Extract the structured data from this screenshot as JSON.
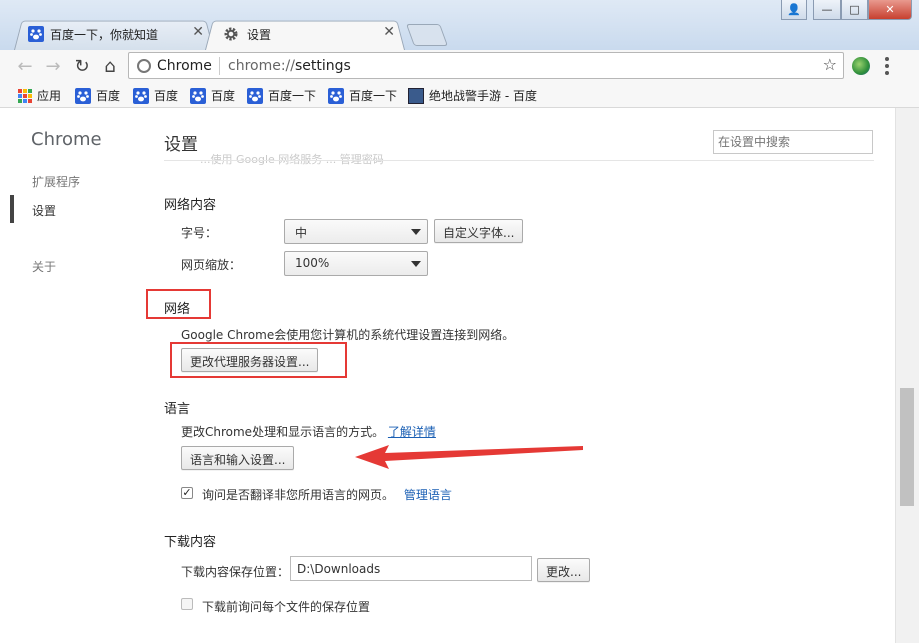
{
  "tabs": [
    {
      "label": "百度一下，你就知道",
      "icon": "baidu-paw-icon"
    },
    {
      "label": "设置",
      "icon": "gear-icon"
    }
  ],
  "window_controls": {
    "user": "👤",
    "minimize": "—",
    "maximize": "□",
    "close": "✕"
  },
  "omnibox": {
    "chip_label": "Chrome",
    "url_scheme": "chrome://",
    "url_path": "settings"
  },
  "bookmarks": {
    "apps_label": "应用",
    "items": [
      "百度",
      "百度",
      "百度",
      "百度一下",
      "百度一下",
      "绝地战警手游 - 百度"
    ]
  },
  "sidebar": {
    "title": "Chrome",
    "items": [
      "扩展程序",
      "设置",
      "关于"
    ]
  },
  "settings": {
    "title": "设置",
    "search_placeholder": "在设置中搜索",
    "faded_text": "...使用 Google 网络服务 ... 管理密码",
    "web_content": {
      "heading": "网络内容",
      "font_size_label": "字号：",
      "font_size_value": "中",
      "custom_fonts_button": "自定义字体...",
      "zoom_label": "网页缩放：",
      "zoom_value": "100%"
    },
    "network": {
      "heading": "网络",
      "description": "Google Chrome会使用您计算机的系统代理设置连接到网络。",
      "proxy_button": "更改代理服务器设置..."
    },
    "language": {
      "heading": "语言",
      "description": "更改Chrome处理和显示语言的方式。",
      "learn_more": "了解详情",
      "input_button": "语言和输入设置...",
      "translate_checkbox_label": "询问是否翻译非您所用语言的网页。",
      "translate_checked": true,
      "manage_languages": "管理语言"
    },
    "downloads": {
      "heading": "下载内容",
      "location_label": "下载内容保存位置：",
      "location_value": "D:\\Downloads",
      "change_button": "更改...",
      "ask_checkbox_label": "下载前询问每个文件的保存位置",
      "ask_checked": false
    }
  },
  "colors": {
    "annotation_red": "#e53935",
    "link_blue": "#1a5fb4"
  }
}
